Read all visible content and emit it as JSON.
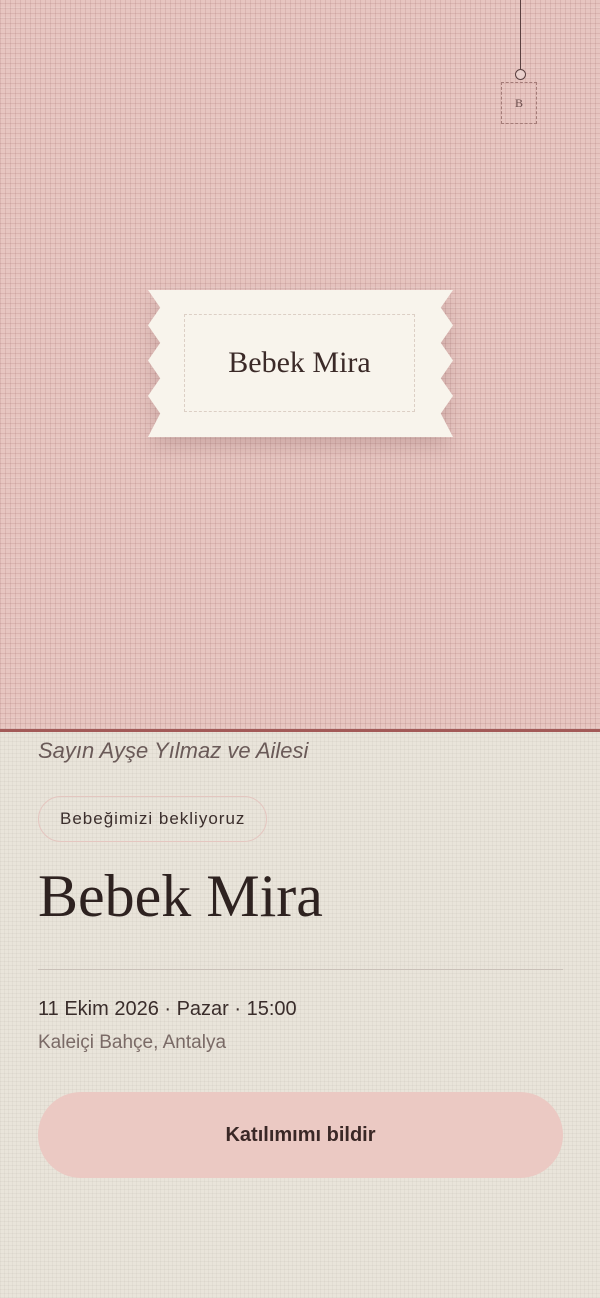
{
  "hero": {
    "tag_letter": "B",
    "label_text": "Bebek Mira"
  },
  "invitation": {
    "greeting": "Sayın Ayşe Yılmaz ve Ailesi",
    "badge": "Bebeğimizi bekliyoruz",
    "baby_name": "Bebek Mira",
    "datetime": "11 Ekim 2026 · Pazar · 15:00",
    "location": "Kaleiçi Bahçe, Antalya",
    "rsvp_label": "Katılımımı bildir"
  },
  "colors": {
    "hero_pink": "#e7c5c0",
    "accent_border": "#a35a58",
    "paper": "#e9e4da",
    "button": "#ebc9c3",
    "text_dark": "#2e2220"
  }
}
